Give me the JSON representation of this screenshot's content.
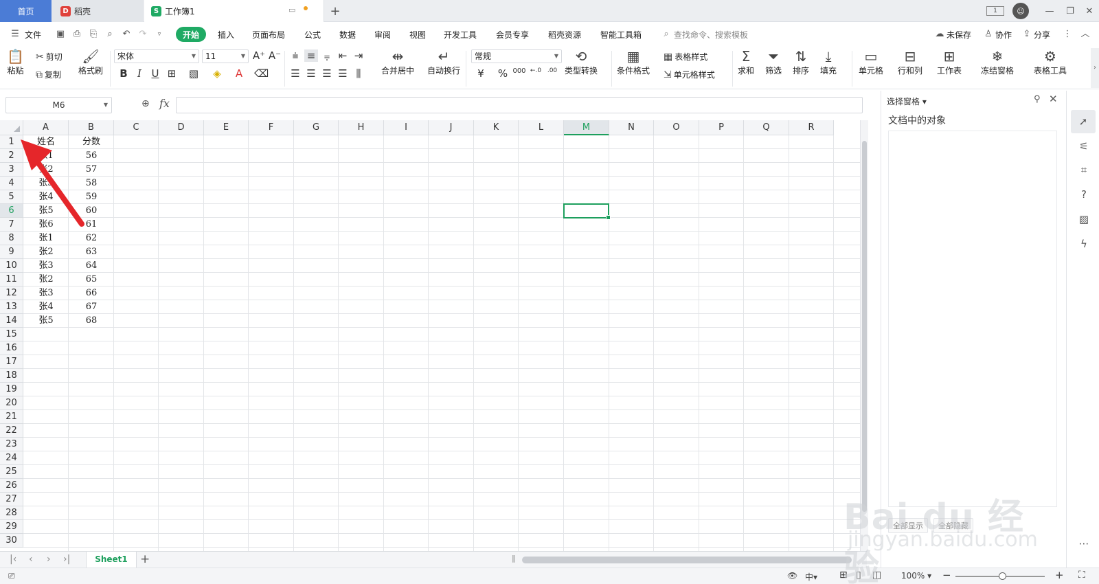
{
  "tabs": {
    "home": "首页",
    "daoke": "稻壳",
    "workbook": "工作簿1",
    "add": "+"
  },
  "menu": {
    "file": "文件",
    "start": "开始",
    "items": [
      "插入",
      "页面布局",
      "公式",
      "数据",
      "审阅",
      "视图",
      "开发工具",
      "会员专享",
      "稻壳资源",
      "智能工具箱"
    ],
    "search": "查找命令、搜索模板",
    "unsaved": "未保存",
    "collab": "协作",
    "share": "分享"
  },
  "ribbon": {
    "paste": "粘贴",
    "cut": "剪切",
    "copy": "复制",
    "format_painter": "格式刷",
    "font": "宋体",
    "font_size": "11",
    "merge": "合并居中",
    "wrap": "自动换行",
    "number_format": "常规",
    "type_convert": "类型转换",
    "cond_format": "条件格式",
    "table_style": "表格样式",
    "cell_style": "单元格样式",
    "sum": "求和",
    "filter": "筛选",
    "sort": "排序",
    "fill": "填充",
    "cell": "单元格",
    "rowcol": "行和列",
    "worksheet": "工作表",
    "freeze": "冻结窗格",
    "table_tools": "表格工具"
  },
  "namebox": "M6",
  "fx": "fx",
  "columns": [
    "A",
    "B",
    "C",
    "D",
    "E",
    "F",
    "G",
    "H",
    "I",
    "J",
    "K",
    "L",
    "M",
    "N",
    "O",
    "P",
    "Q",
    "R"
  ],
  "active_col": "M",
  "active_row": 6,
  "row_count": 30,
  "cells": {
    "A": [
      "姓名",
      "张1",
      "张2",
      "张3",
      "张4",
      "张5",
      "张6",
      "张1",
      "张2",
      "张3",
      "张2",
      "张3",
      "张4",
      "张5"
    ],
    "B": [
      "分数",
      "56",
      "57",
      "58",
      "59",
      "60",
      "61",
      "62",
      "63",
      "64",
      "65",
      "66",
      "67",
      "68"
    ]
  },
  "sheet": {
    "tab": "Sheet1"
  },
  "status": {
    "zoom": "100%"
  },
  "pane": {
    "title": "选择窗格",
    "subtitle": "文档中的对象",
    "show_all": "全部显示",
    "hide_all": "全部隐藏"
  },
  "watermark": {
    "text": "Bai du 经验",
    "url": "jingyan.baidu.com"
  },
  "colors": {
    "accent": "#1d9f5d",
    "home_tab": "#4b7cd6",
    "arrow": "#e5262a"
  }
}
